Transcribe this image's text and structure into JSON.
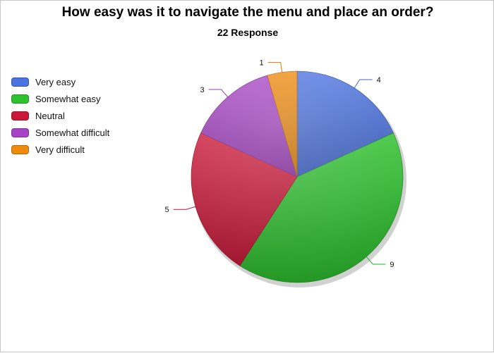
{
  "chart_data": {
    "type": "pie",
    "title": "How easy was it to navigate the menu and place an order?",
    "subtitle": "22 Response",
    "legend_position": "left",
    "slices": [
      {
        "label": "Very easy",
        "value": 4,
        "color": "#4a72e0"
      },
      {
        "label": "Somewhat easy",
        "value": 9,
        "color": "#2ec12e"
      },
      {
        "label": "Neutral",
        "value": 5,
        "color": "#cc1838"
      },
      {
        "label": "Somewhat difficult",
        "value": 3,
        "color": "#a743c6"
      },
      {
        "label": "Very difficult",
        "value": 1,
        "color": "#f08a0c"
      }
    ]
  }
}
